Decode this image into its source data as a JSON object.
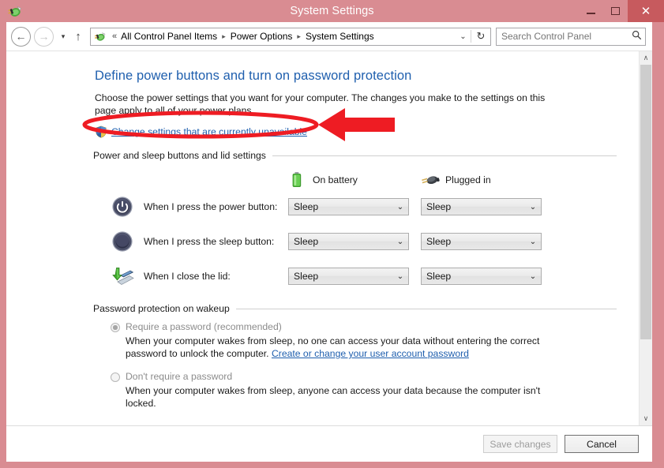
{
  "window": {
    "title": "System Settings",
    "app_icon": "power-plug-icon",
    "controls": {
      "minimize": "–",
      "maximize": "□",
      "close": "✕"
    }
  },
  "nav": {
    "back": "←",
    "forward": "→",
    "recent": "▾",
    "up": "↑",
    "address_icon": "power-plug-icon",
    "overflow_chevron": "«",
    "breadcrumbs": [
      "All Control Panel Items",
      "Power Options",
      "System Settings"
    ],
    "breadcrumb_separator": "▸",
    "address_dropdown": "⌄",
    "refresh": "↻"
  },
  "search": {
    "placeholder": "Search Control Panel",
    "value": "",
    "icon": "search-icon"
  },
  "page": {
    "title": "Define power buttons and turn on password protection",
    "intro": "Choose the power settings that you want for your computer. The changes you make to the settings on this page apply to all of your power plans.",
    "uac_link": "Change settings that are currently unavailable"
  },
  "buttons_group": {
    "header": "Power and sleep buttons and lid settings",
    "columns": [
      {
        "label": "On battery",
        "icon": "battery-icon"
      },
      {
        "label": "Plugged in",
        "icon": "power-plug-icon"
      }
    ],
    "rows": [
      {
        "icon": "power-button-icon",
        "label": "When I press the power button:",
        "on_battery": "Sleep",
        "plugged_in": "Sleep"
      },
      {
        "icon": "sleep-button-icon",
        "label": "When I press the sleep button:",
        "on_battery": "Sleep",
        "plugged_in": "Sleep"
      },
      {
        "icon": "laptop-lid-icon",
        "label": "When I close the lid:",
        "on_battery": "Sleep",
        "plugged_in": "Sleep"
      }
    ],
    "dropdown_arrow": "⌄"
  },
  "password_group": {
    "header": "Password protection on wakeup",
    "options": [
      {
        "label": "Require a password (recommended)",
        "selected": true,
        "desc_before": "When your computer wakes from sleep, no one can access your data without entering the correct password to unlock the computer. ",
        "link": "Create or change your user account password"
      },
      {
        "label": "Don't require a password",
        "selected": false,
        "desc_before": "When your computer wakes from sleep, anyone can access your data because the computer isn't locked.",
        "link": ""
      }
    ]
  },
  "footer": {
    "save_label": "Save changes",
    "save_disabled": true,
    "cancel_label": "Cancel"
  },
  "scrollbar": {
    "up_arrow": "∧",
    "down_arrow": "∨"
  },
  "annotations": {
    "highlight_color": "#ee1c23",
    "shape": "ellipse-around-uac-link",
    "arrow": "left-pointing-arrow"
  },
  "colors": {
    "titlebar": "#d98c92",
    "close_button": "#c75a5e",
    "link": "#1f5fae",
    "heading": "#1f5fae",
    "annotation_red": "#ee1c23"
  }
}
